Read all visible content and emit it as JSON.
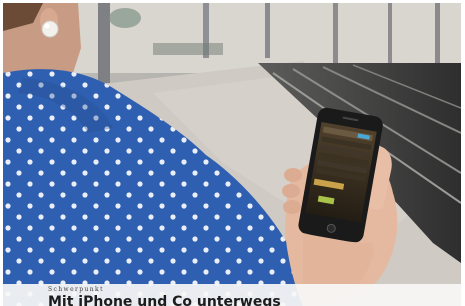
{
  "caption": {
    "kicker": "Schwerpunkt",
    "headline": "Mit iPhone und Co unterwegs"
  },
  "colors": {
    "shirt": "#2f5fb0",
    "dots": "#e9eef8",
    "skin": "#e5b9a0",
    "platform": "#cfcac3",
    "track": "#4a4a4a",
    "phone": "#1a1a1a",
    "caption_bg": "#f6f6f4"
  }
}
